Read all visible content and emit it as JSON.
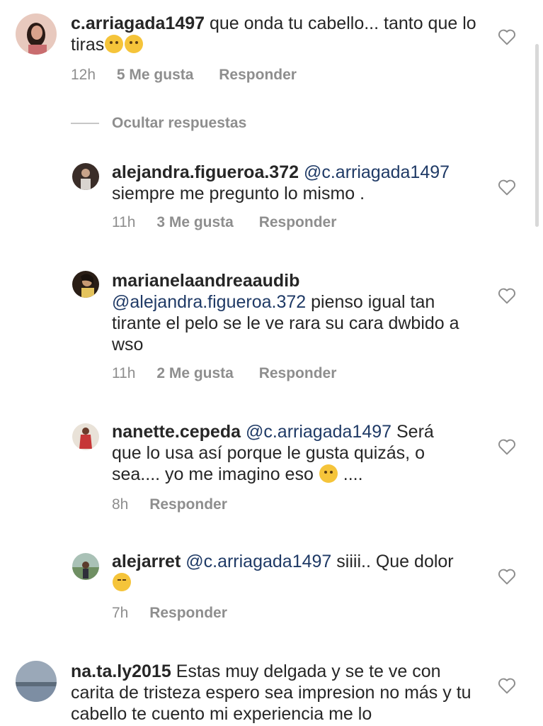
{
  "comments": [
    {
      "username": "c.arriagada1497",
      "text": "que onda tu cabello... tanto que lo tiras",
      "emoji": "😢😢",
      "time": "12h",
      "likes": "5 Me gusta",
      "reply": "Responder",
      "avatar_color": "#d9a28c"
    }
  ],
  "hide_replies": "Ocultar respuestas",
  "replies": [
    {
      "username": "alejandra.figueroa.372",
      "mention": "@c.arriagada1497",
      "text": "siempre me pregunto lo mismo .",
      "time": "11h",
      "likes": "3 Me gusta",
      "reply": "Responder",
      "avatar_color": "#4a3a32"
    },
    {
      "username": "marianelaandreaaudib",
      "mention": "@alejandra.figueroa.372",
      "text": "pienso igual tan tirante el pelo se le ve rara su cara dwbido a wso",
      "time": "11h",
      "likes": "2 Me gusta",
      "reply": "Responder",
      "avatar_color": "#3b2a1e"
    },
    {
      "username": "nanette.cepeda",
      "mention": "@c.arriagada1497",
      "text": "Será que lo usa así porque le gusta quizás,  o sea.... yo me imagino eso",
      "emoji": "🤔",
      "text_after": " ....",
      "time": "8h",
      "reply": "Responder",
      "avatar_color": "#b0413e"
    },
    {
      "username": "alejarret",
      "mention": "@c.arriagada1497",
      "text": "siiii.. Que dolor",
      "emoji": "😂",
      "time": "7h",
      "reply": "Responder",
      "avatar_color": "#6f8f63"
    }
  ],
  "bottom_comment": {
    "username": "na.ta.ly2015",
    "text": "Estas muy delgada y se te ve con carita de tristeza espero sea impresion no más y tu cabello te cuento mi experiencia me lo",
    "avatar_color": "#7d8ea3"
  },
  "icons": {
    "like": "heart-icon"
  }
}
